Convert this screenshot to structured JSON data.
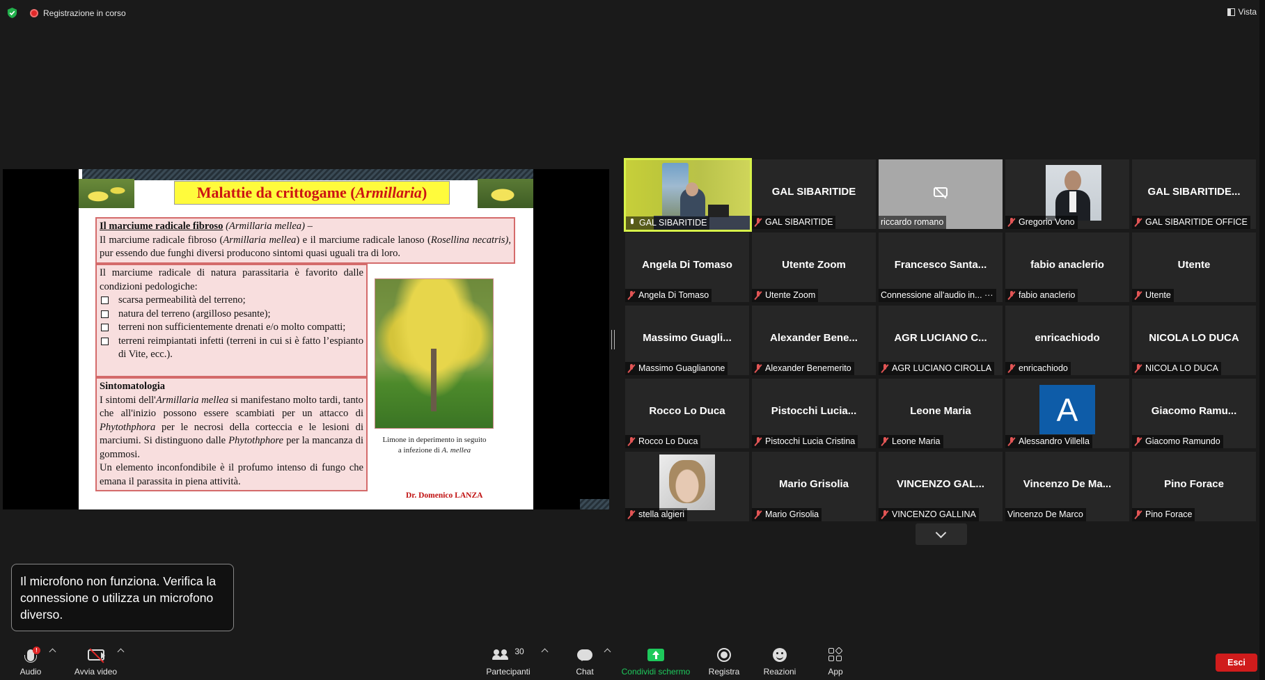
{
  "topbar": {
    "recording_label": "Registrazione in corso",
    "view_label": "Vista"
  },
  "slide": {
    "title_main": "Malattie da crittogame (",
    "title_italic": "Armillaria",
    "title_end": ")",
    "box1": {
      "heading": "Il marciume radicale fibroso",
      "heading_italic": "(Armillaria mellea)",
      "heading_tail": " –",
      "text_1": "Il marciume radicale fibroso (",
      "text_1_italic": "Armillaria mellea",
      "text_2": ") e il marciume radicale lanoso (",
      "text_2_italic": "Rosellina necatris)",
      "text_3": ", pur essendo due funghi diversi producono sintomi quasi uguali tra di loro."
    },
    "box2": {
      "intro": "Il marciume radicale di natura parassitaria è favorito dalle condizioni pedologiche:",
      "bullets": [
        "scarsa permeabilità del terreno;",
        "natura del terreno (argilloso pesante);",
        "terreni non sufficientemente drenati e/o molto compatti;",
        "terreni reimpiantati infetti (terreni in cui si è fatto l’espianto di Vite, ecc.)."
      ]
    },
    "box3": {
      "heading": "Sintomatologia",
      "t1": "I sintomi dell'",
      "t1_i": "Armillaria mellea",
      "t2": " si manifestano molto tardi, tanto che all'inizio possono essere scambiati per un attacco di ",
      "t2_i": "Phytothphora",
      "t3": " per le necrosi della corteccia e le lesioni di marciumi. Si distinguono dalle ",
      "t3_i": "Phytothphore",
      "t4": " per la mancanza di gommosi.",
      "t5": "Un elemento inconfondibile è il profumo intenso di fungo che emana il parassita in piena attività."
    },
    "caption_1": "Limone in deperimento in seguito a infezione di ",
    "caption_italic": "A. mellea",
    "author": "Dr. Domenico LANZA"
  },
  "participants": [
    {
      "big": "",
      "label": "GAL SIBARITIDE",
      "mic": "on",
      "kind": "speaker"
    },
    {
      "big": "GAL SIBARITIDE",
      "label": "GAL SIBARITIDE",
      "mic": "muted"
    },
    {
      "big": "",
      "label": "riccardo romano",
      "mic": "none",
      "kind": "camoff"
    },
    {
      "big": "",
      "label": "Gregorio Vono",
      "mic": "muted",
      "kind": "photo-gv"
    },
    {
      "big": "GAL SIBARITIDE...",
      "label": "GAL SIBARITIDE OFFICE",
      "mic": "muted"
    },
    {
      "big": "Angela Di Tomaso",
      "label": "Angela Di Tomaso",
      "mic": "muted"
    },
    {
      "big": "Utente Zoom",
      "label": "Utente Zoom",
      "mic": "muted"
    },
    {
      "big": "Francesco  Santa...",
      "label": "Connessione all'audio in... ···",
      "mic": "none"
    },
    {
      "big": "fabio anaclerio",
      "label": "fabio anaclerio",
      "mic": "muted"
    },
    {
      "big": "Utente",
      "label": "Utente",
      "mic": "muted"
    },
    {
      "big": "Massimo  Guagli...",
      "label": "Massimo Guaglianone",
      "mic": "muted"
    },
    {
      "big": "Alexander  Bene...",
      "label": "Alexander Benemerito",
      "mic": "muted"
    },
    {
      "big": "AGR LUCIANO C...",
      "label": "AGR LUCIANO CIROLLA",
      "mic": "muted"
    },
    {
      "big": "enricachiodo",
      "label": "enricachiodo",
      "mic": "muted"
    },
    {
      "big": "NICOLA LO DUCA",
      "label": "NICOLA LO DUCA",
      "mic": "muted"
    },
    {
      "big": "Rocco Lo Duca",
      "label": "Rocco Lo Duca",
      "mic": "muted"
    },
    {
      "big": "Pistocchi  Lucia...",
      "label": "Pistocchi Lucia Cristina",
      "mic": "muted"
    },
    {
      "big": "Leone Maria",
      "label": "Leone Maria",
      "mic": "muted"
    },
    {
      "big": "",
      "label": "Alessandro Villella",
      "mic": "muted",
      "kind": "avatar-a",
      "avatar_letter": "A"
    },
    {
      "big": "Giacomo  Ramu...",
      "label": "Giacomo Ramundo",
      "mic": "muted"
    },
    {
      "big": "",
      "label": "stella algieri",
      "mic": "muted",
      "kind": "photo-sa"
    },
    {
      "big": "Mario Grisolia",
      "label": "Mario Grisolia",
      "mic": "muted"
    },
    {
      "big": "VINCENZO  GAL...",
      "label": "VINCENZO GALLINA",
      "mic": "muted"
    },
    {
      "big": "Vincenzo  De  Ma...",
      "label": "Vincenzo De Marco",
      "mic": "none"
    },
    {
      "big": "Pino Forace",
      "label": "Pino Forace",
      "mic": "muted"
    }
  ],
  "notification": "Il microfono non funziona. Verifica la connessione o utilizza un microfono diverso.",
  "toolbar": {
    "audio": "Audio",
    "audio_badge": "!",
    "video": "Avvia video",
    "participants": "Partecipanti",
    "participants_count": "30",
    "chat": "Chat",
    "share": "Condividi schermo",
    "record": "Registra",
    "reactions": "Reazioni",
    "apps": "App",
    "leave": "Esci"
  },
  "colors": {
    "share_green": "#1ec95c",
    "leave_red": "#d01c1c",
    "active_speaker": "#d7f24a",
    "muted_red": "#e25555"
  }
}
